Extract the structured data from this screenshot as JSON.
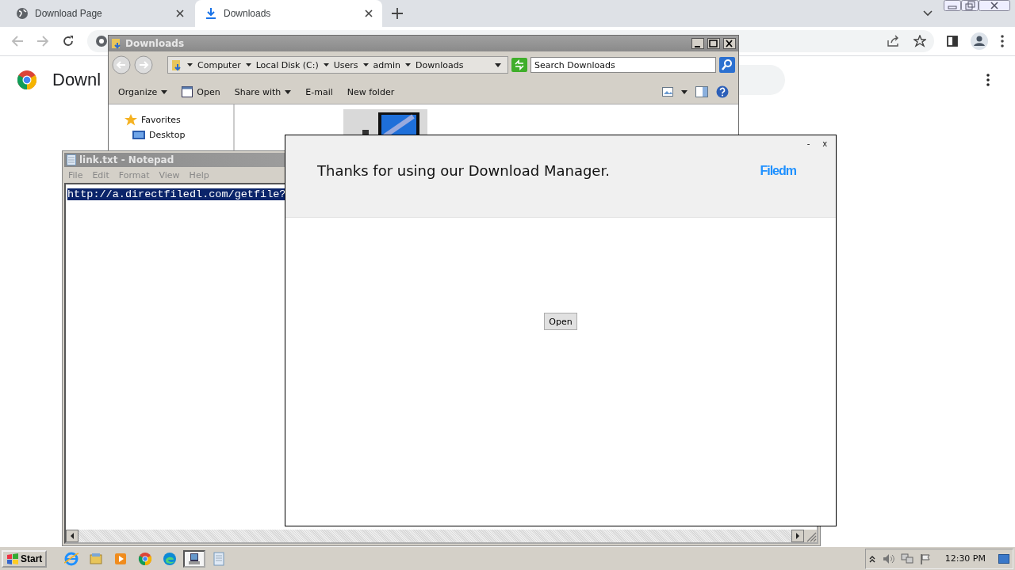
{
  "browser": {
    "tabs": [
      {
        "title": "Download Page",
        "kind": "globe",
        "selected": false
      },
      {
        "title": "Downloads",
        "kind": "download",
        "selected": true
      }
    ],
    "page_heading": "Downl"
  },
  "explorer": {
    "title": "Downloads",
    "breadcrumb": [
      "Computer",
      "Local Disk (C:)",
      "Users",
      "admin",
      "Downloads"
    ],
    "search": {
      "placeholder": "Search Downloads"
    },
    "toolbar": [
      {
        "label": "Organize",
        "kind": "menu"
      },
      {
        "label": "Open",
        "kind": "icon"
      },
      {
        "label": "Share with",
        "kind": "menu"
      },
      {
        "label": "E-mail",
        "kind": "plain"
      },
      {
        "label": "New folder",
        "kind": "plain"
      }
    ],
    "nav": [
      {
        "label": "Favorites",
        "kind": "star",
        "children": [
          {
            "label": "Desktop",
            "kind": "desktop"
          }
        ]
      }
    ]
  },
  "notepad": {
    "title": "link.txt - Notepad",
    "menu": [
      "File",
      "Edit",
      "Format",
      "View",
      "Help"
    ],
    "text": "http://a.directfiledl.com/getfile?",
    "selected": true
  },
  "dialog": {
    "message": "Thanks for using our Download Manager.",
    "logo": "Filedm",
    "minimize": "-",
    "close": "x",
    "button": "Open"
  },
  "taskbar": {
    "start": "Start",
    "apps": [
      {
        "kind": "ie",
        "selected": false
      },
      {
        "kind": "folder",
        "selected": false
      },
      {
        "kind": "media",
        "selected": false
      },
      {
        "kind": "chrome",
        "selected": false
      },
      {
        "kind": "edge",
        "selected": false
      },
      {
        "kind": "installer",
        "selected": true
      },
      {
        "kind": "notepad",
        "selected": false
      }
    ],
    "clock": "12:30 PM"
  }
}
